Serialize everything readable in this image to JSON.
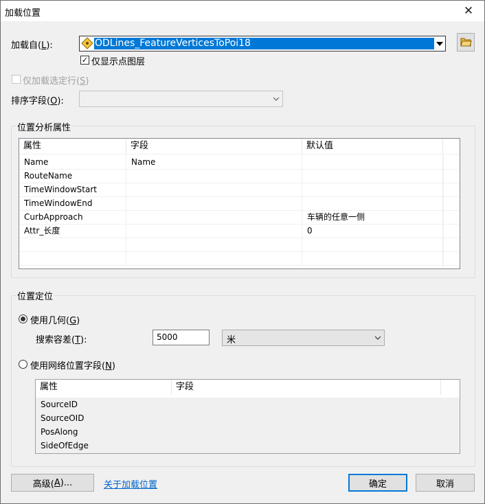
{
  "window": {
    "title": "加载位置",
    "close_glyph": "✕"
  },
  "load_from": {
    "label": "加载自(",
    "hotkey": "L",
    "label_end": "):",
    "value": "ODLines_FeatureVerticesToPoi18",
    "icon": "feature-layer-icon",
    "browse_icon": "open-folder-icon"
  },
  "only_points": {
    "label": "仅显示点图层",
    "checked": true
  },
  "only_selected": {
    "label": "仅加载选定行(",
    "hotkey": "S",
    "label_end": ")",
    "checked": false,
    "enabled": false
  },
  "sort_field": {
    "label": "排序字段(",
    "hotkey": "O",
    "label_end": "):",
    "value": ""
  },
  "location_props": {
    "group_title": "位置分析属性",
    "columns": [
      "属性",
      "字段",
      "默认值"
    ],
    "rows": [
      [
        "Name",
        "Name",
        ""
      ],
      [
        "RouteName",
        "",
        ""
      ],
      [
        "TimeWindowStart",
        "",
        ""
      ],
      [
        "TimeWindowEnd",
        "",
        ""
      ],
      [
        "CurbApproach",
        "",
        "车辆的任意一侧"
      ],
      [
        "Attr_长度",
        "",
        "0"
      ],
      [
        "",
        "",
        ""
      ],
      [
        "",
        "",
        ""
      ]
    ]
  },
  "positioning": {
    "group_title": "位置定位",
    "use_geometry": {
      "label": "使用几何(",
      "hotkey": "G",
      "label_end": ")",
      "selected": true
    },
    "tolerance": {
      "label": "搜索容差(",
      "hotkey": "T",
      "label_end": "):",
      "value": "5000",
      "unit": "米"
    },
    "use_network": {
      "label": "使用网络位置字段(",
      "hotkey": "N",
      "label_end": ")",
      "selected": false
    },
    "columns": [
      "属性",
      "字段"
    ],
    "rows": [
      [
        "SourceID",
        ""
      ],
      [
        "SourceOID",
        ""
      ],
      [
        "PosAlong",
        ""
      ],
      [
        "SideOfEdge",
        ""
      ]
    ]
  },
  "footer": {
    "advanced": {
      "label": "高级(",
      "hotkey": "A",
      "label_end": ")..."
    },
    "about_link": "关于加载位置",
    "ok": "确定",
    "cancel": "取消"
  }
}
